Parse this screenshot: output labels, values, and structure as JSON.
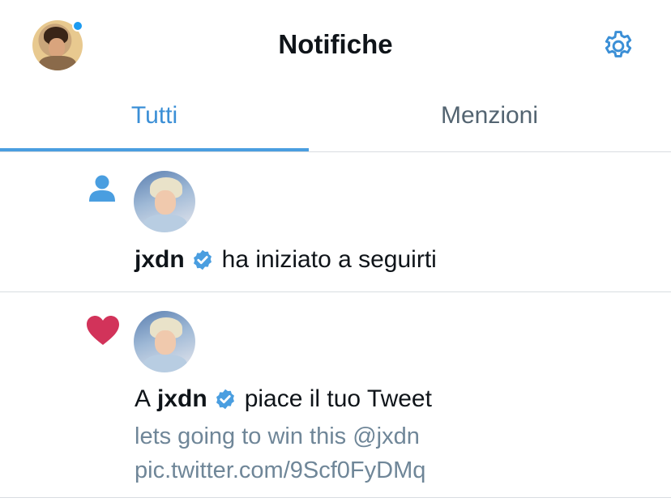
{
  "header": {
    "title": "Notifiche",
    "settings_icon": "gear-icon",
    "accent_color": "#1d9bf0"
  },
  "tabs": [
    {
      "label": "Tutti",
      "active": true
    },
    {
      "label": "Menzioni",
      "active": false
    }
  ],
  "notifications": [
    {
      "type": "follow",
      "icon": "person-icon",
      "username": "jxdn",
      "verified": true,
      "text": "ha iniziato a seguirti"
    },
    {
      "type": "like",
      "icon": "heart-icon",
      "prefix": "A",
      "username": "jxdn",
      "verified": true,
      "text": "piace il tuo Tweet",
      "tweet_line_1": "lets going to win this @jxdn",
      "tweet_line_2": "pic.twitter.com/9Scf0FyDMq"
    }
  ],
  "colors": {
    "like": "#e0245e",
    "follow": "#1d9bf0",
    "secondary_text": "#6f8698"
  }
}
